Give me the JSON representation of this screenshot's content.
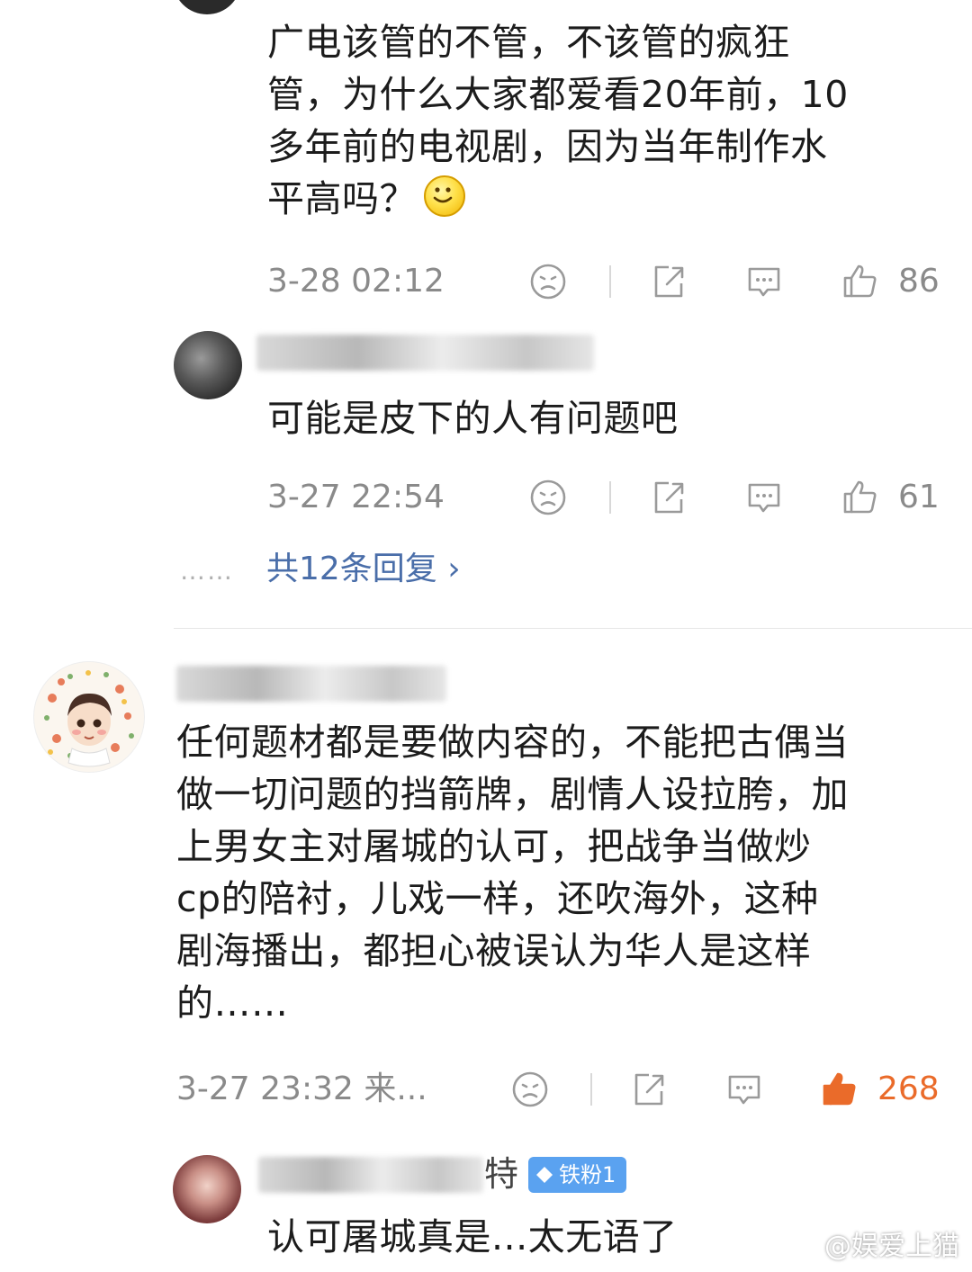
{
  "top_comment": {
    "text_lines": [
      "广电该管的不管，不该管的疯狂",
      "管，为什么大家都爱看20年前，10",
      "多年前的电视剧，因为当年制作水",
      "平高吗？"
    ],
    "emoji": "smile-emoji",
    "time": "3-28 02:12",
    "likes": "86"
  },
  "reply_1": {
    "text": "可能是皮下的人有问题吧",
    "time": "3-27 22:54",
    "likes": "61"
  },
  "more_replies": {
    "dots": "……",
    "label": "共12条回复 ›"
  },
  "comment_2": {
    "text_lines": [
      "任何题材都是要做内容的，不能把古偶当",
      "做一切问题的挡箭牌，剧情人设拉胯，加",
      "上男女主对屠城的认可，把战争当做炒",
      "cp的陪衬，儿戏一样，还吹海外，这种",
      "剧海播出，都担心被误认为华人是这样",
      "的……"
    ],
    "time": "3-27 23:32 来...",
    "likes": "268",
    "like_color": "#ea6b2a"
  },
  "reply_2": {
    "name_suffix": "特",
    "badge": "铁粉1",
    "text": "认可屠城真是...太无语了"
  },
  "watermark": "@娱爱上猫",
  "icons": {
    "dislike": "sad-face-icon",
    "share": "share-icon",
    "comment": "comment-bubble-icon",
    "like": "thumbs-up-icon"
  }
}
